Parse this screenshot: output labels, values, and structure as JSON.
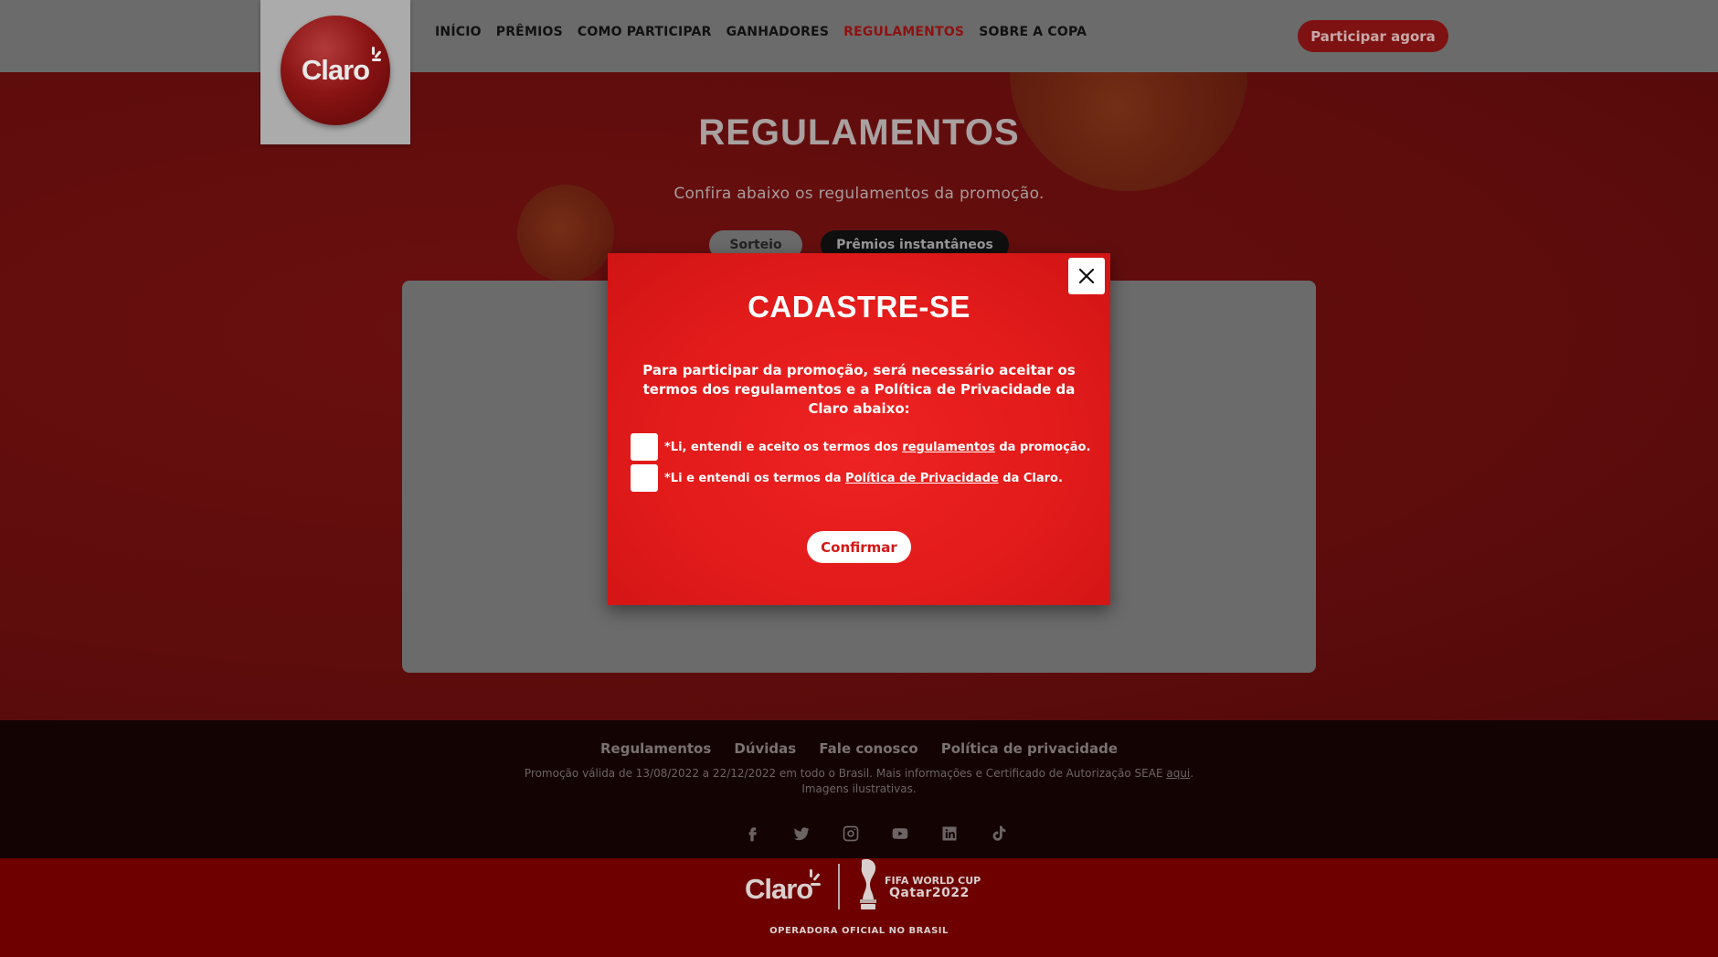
{
  "header": {
    "logo_text": "Claro",
    "nav": [
      {
        "label": "INÍCIO"
      },
      {
        "label": "PRÊMIOS"
      },
      {
        "label": "COMO PARTICIPAR"
      },
      {
        "label": "GANHADORES"
      },
      {
        "label": "REGULAMENTOS",
        "active": true
      },
      {
        "label": "SOBRE A COPA"
      }
    ],
    "cta_label": "Participar agora"
  },
  "main": {
    "title": "REGULAMENTOS",
    "subtitle": "Confira abaixo os regulamentos da promoção.",
    "tabs": [
      {
        "label": "Sorteio"
      },
      {
        "label": "Prêmios instantâneos"
      }
    ]
  },
  "modal": {
    "title": "CADASTRE-SE",
    "text": "Para participar da promoção, será necessário aceitar os termos dos regulamentos e a Política de Privacidade da Claro abaixo:",
    "check1": {
      "prefix": "*Li, entendi e aceito os termos dos ",
      "link": "regulamentos",
      "suffix": " da promoção."
    },
    "check2": {
      "prefix": "*Li e entendi os termos da ",
      "link": "Política de Privacidade",
      "suffix": " da Claro."
    },
    "confirm_label": "Confirmar",
    "close_icon": "close-icon"
  },
  "footer": {
    "links": [
      "Regulamentos",
      "Dúvidas",
      "Fale conosco",
      "Política de privacidade"
    ],
    "note_prefix": "Promoção válida de 13/08/2022 a 22/12/2022 em todo o Brasil. Mais informações e Certificado de Autorização SEAE ",
    "note_link": "aqui",
    "note_suffix": ".",
    "note_line2": "Imagens ilustrativas.",
    "socials": [
      "facebook-icon",
      "twitter-icon",
      "instagram-icon",
      "youtube-icon",
      "linkedin-icon",
      "tiktok-icon"
    ]
  },
  "brand_bar": {
    "claro": "Claro",
    "fifa": "FIFA WORLD CUP",
    "qatar": "Qatar2022",
    "tagline": "OPERADORA OFICIAL NO BRASIL"
  },
  "colors": {
    "modal_red": "#e31b1b",
    "active_nav": "#8e1111",
    "footer_bg": "#140303",
    "brand_bar_bg": "#6e0000"
  }
}
